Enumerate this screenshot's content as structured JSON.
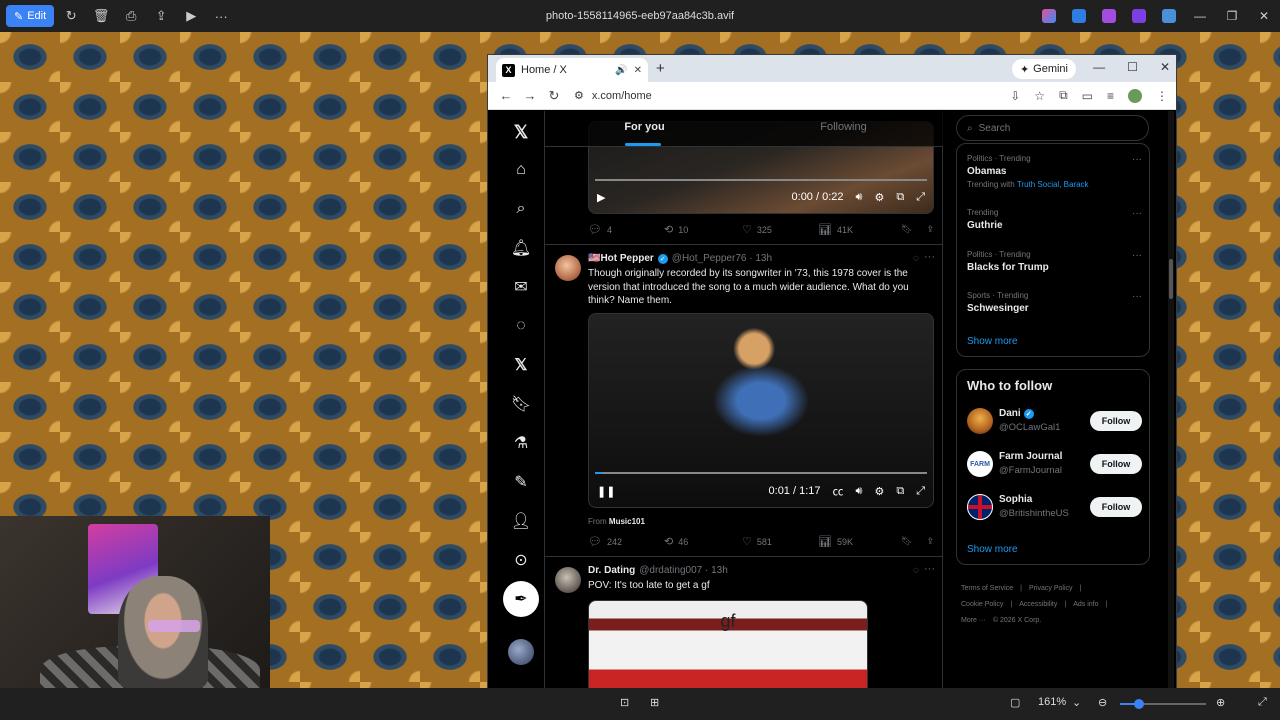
{
  "viewer": {
    "edit_label": "Edit",
    "title": "photo-1558114965-eeb97aa84c3b.avif",
    "zoom": "161%"
  },
  "browser": {
    "tab_title": "Home / X",
    "gemini_label": "Gemini",
    "url": "x.com/home"
  },
  "feed": {
    "tabs": [
      "For you",
      "Following"
    ],
    "top_video": {
      "time": "0:00 / 0:22",
      "replies": "4",
      "reposts": "10",
      "likes": "325",
      "views": "41K"
    },
    "posts": [
      {
        "name": "🇺🇸Hot Pepper",
        "handle": "@Hot_Pepper76 · 13h",
        "text": "Though originally recorded by its songwriter in '73, this 1978 cover is the version that introduced the song to a much wider audience. What do you think? Name them.",
        "video_time": "0:01 / 1:17",
        "from_label": "From",
        "from_source": "Music101",
        "replies": "242",
        "reposts": "46",
        "likes": "581",
        "views": "59K"
      },
      {
        "name": "Dr. Dating",
        "handle": "@drdating007 · 13h",
        "text": "POV: It's too late to get a gf",
        "video_caption": "gf"
      }
    ]
  },
  "sidebar": {
    "search_placeholder": "Search",
    "trends": [
      {
        "category": "Politics · Trending",
        "name": "Obamas",
        "sub_label": "Trending with",
        "sub_links": "Truth Social, Barack"
      },
      {
        "category": "Trending",
        "name": "Guthrie"
      },
      {
        "category": "Politics · Trending",
        "name": "Blacks for Trump"
      },
      {
        "category": "Sports · Trending",
        "name": "Schwesinger"
      }
    ],
    "show_more": "Show more",
    "who_to_follow": {
      "title": "Who to follow",
      "users": [
        {
          "name": "Dani",
          "handle": "@OCLawGal1",
          "verified": true
        },
        {
          "name": "Farm Journal",
          "handle": "@FarmJournal",
          "verified": false
        },
        {
          "name": "Sophia",
          "handle": "@BritishintheUS",
          "verified": false
        }
      ],
      "follow_label": "Follow",
      "show_more": "Show more"
    },
    "footer": [
      "Terms of Service",
      "|",
      "Privacy Policy",
      "|",
      "Cookie Policy",
      "|",
      "Accessibility",
      "|",
      "Ads info",
      "|",
      "More ···",
      "© 2026 X Corp."
    ]
  }
}
